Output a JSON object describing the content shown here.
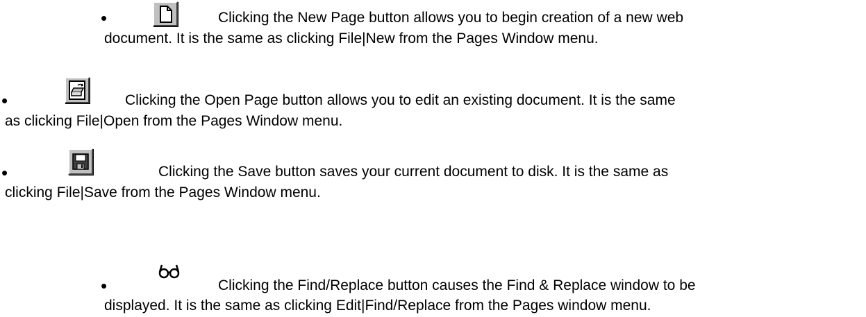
{
  "bullet_char": "•",
  "items": [
    {
      "icon": "new-page-icon",
      "line1": "Clicking the New Page button allows you to begin creation of a new web",
      "line2": "document.   It is the same as clicking File|New from the Pages Window menu."
    },
    {
      "icon": "open-folder-icon",
      "line1": "Clicking the Open Page button allows you to edit an existing document.   It is the same",
      "line2": "as clicking File|Open from the Pages Window menu."
    },
    {
      "icon": "floppy-disk-icon",
      "line1": "Clicking the Save button saves your current document to disk.   It is the same as",
      "line2": "clicking File|Save from the Pages Window menu."
    },
    {
      "icon": "eyeglasses-icon",
      "line1": "Clicking the Find/Replace button causes the Find & Replace window to be",
      "line2": "displayed.   It is the same as clicking Edit|Find/Replace from the Pages window menu."
    }
  ]
}
